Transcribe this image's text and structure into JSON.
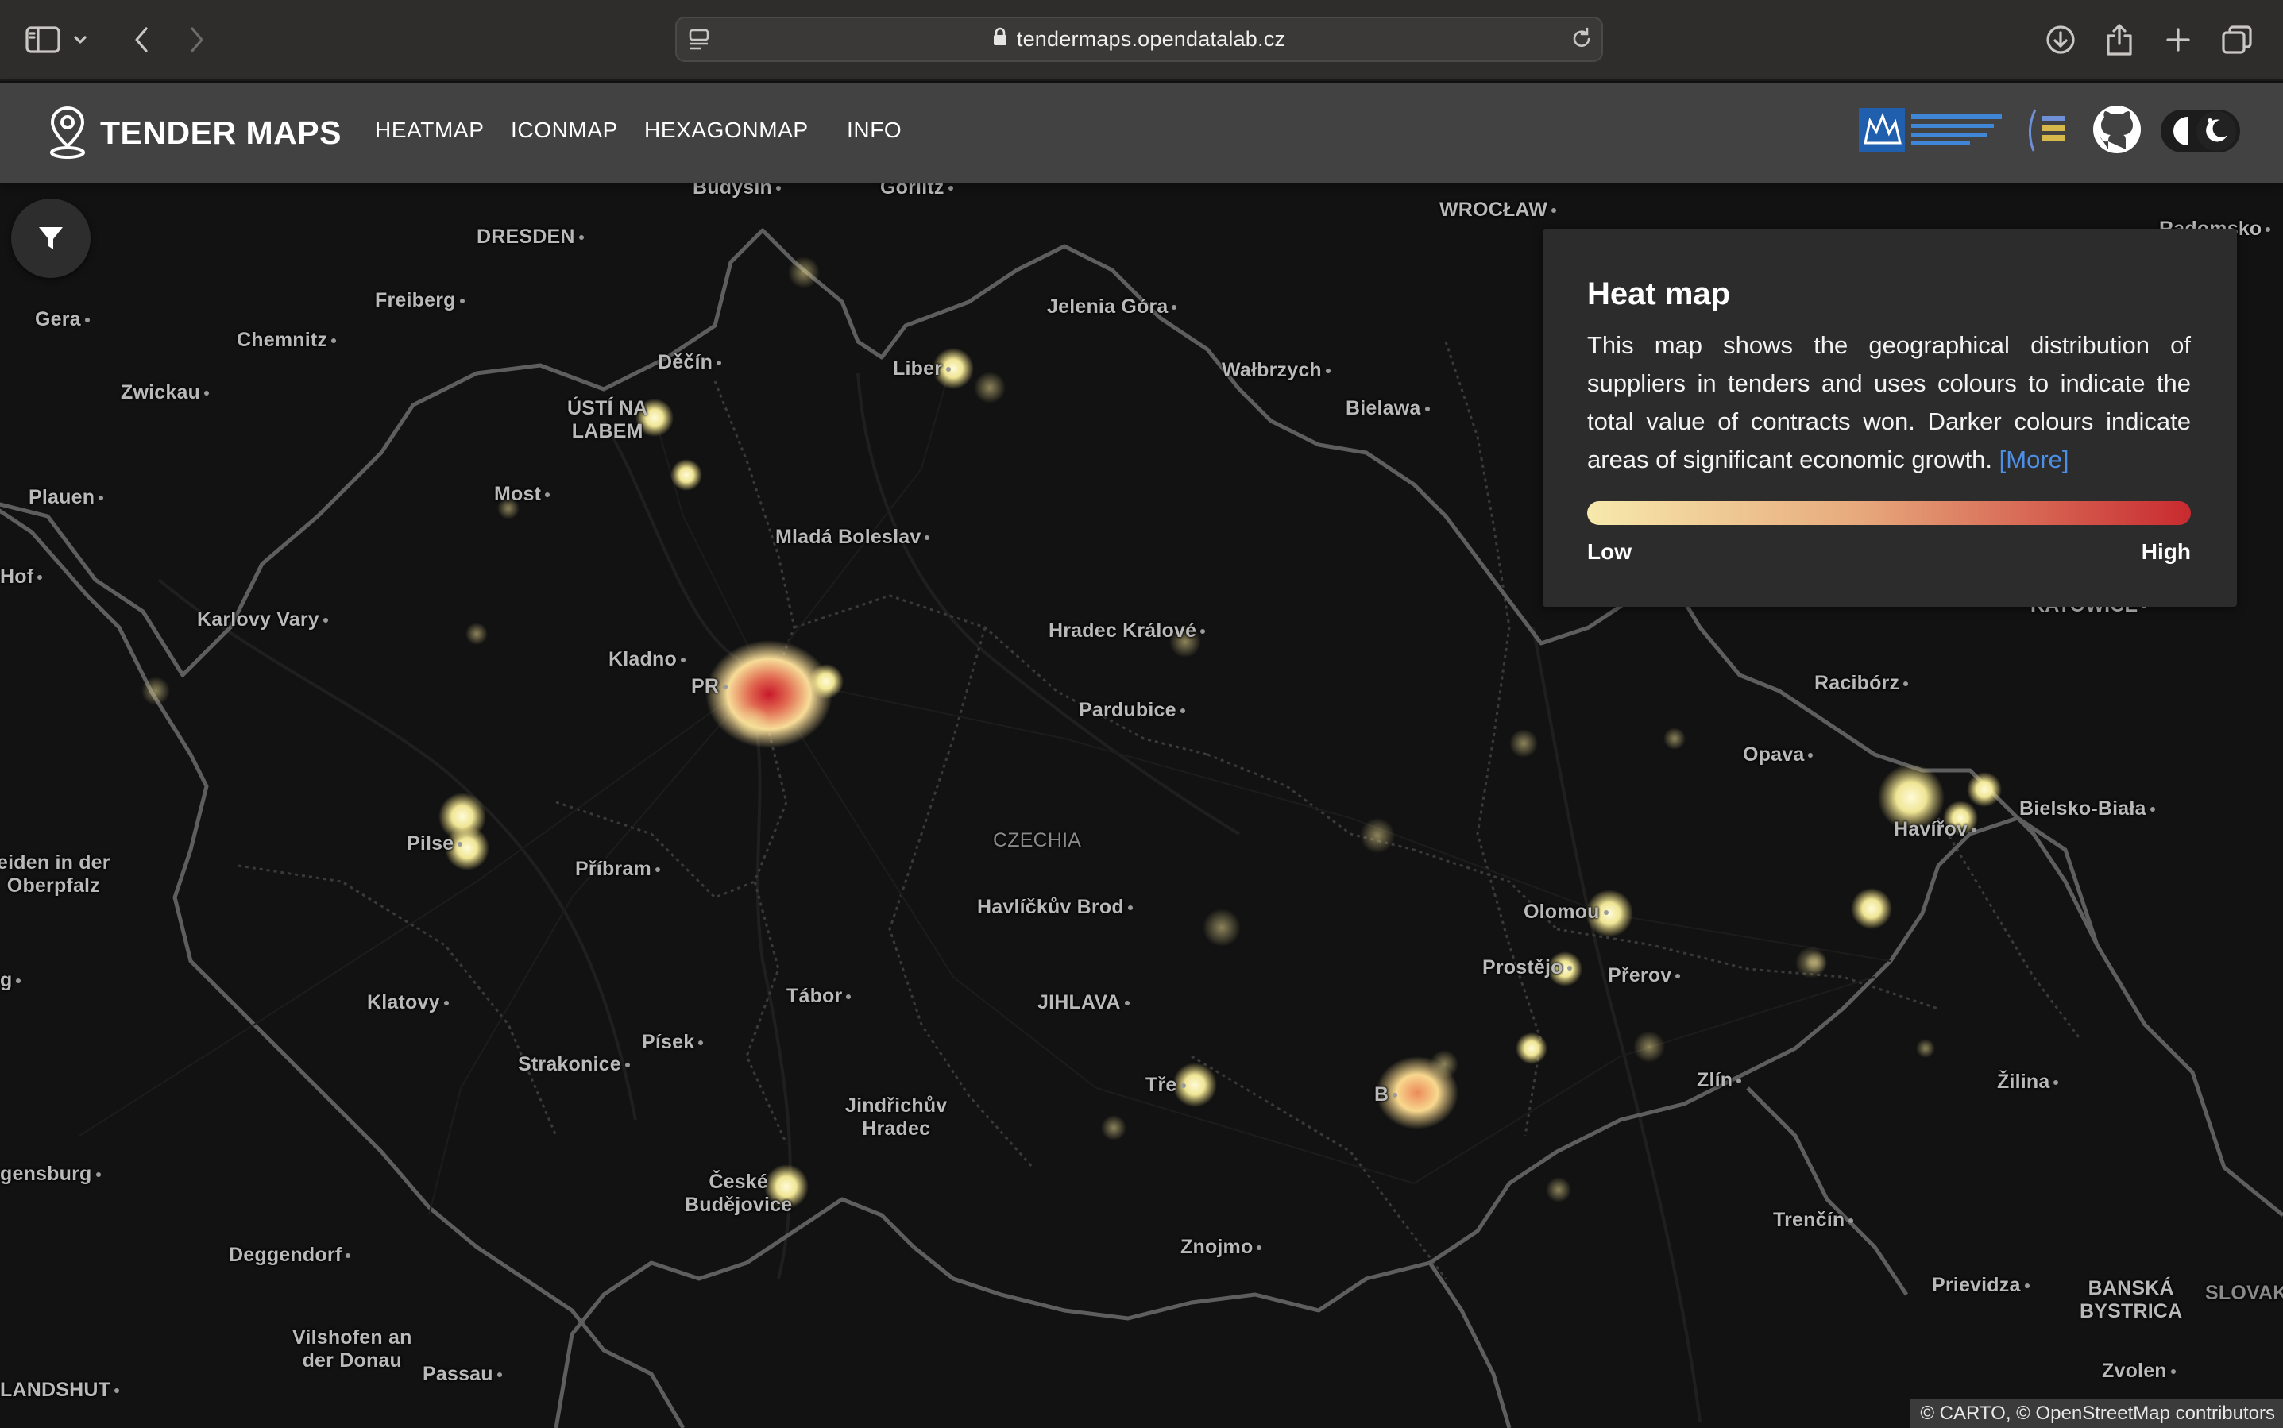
{
  "browser": {
    "url": "tendermaps.opendatalab.cz"
  },
  "nav": {
    "title": "TENDER MAPS",
    "links": [
      "HEATMAP",
      "ICONMAP",
      "HEXAGONMAP",
      "INFO"
    ]
  },
  "map": {
    "places": [
      {
        "label": "Budysin"
      },
      {
        "label": "Gorlitz"
      },
      {
        "label": "DRESDEN"
      },
      {
        "label": "WROCŁAW"
      },
      {
        "label": "Radomsko"
      },
      {
        "label": "Freiberg"
      },
      {
        "label": "Gera"
      },
      {
        "label": "Chemnitz"
      },
      {
        "label": "Jelenia Góra"
      },
      {
        "label": "Děčín"
      },
      {
        "label": "Liber"
      },
      {
        "label": "Wałbrzych"
      },
      {
        "label": "Zwickau"
      },
      {
        "label": "ÚSTÍ NA\nLABEM"
      },
      {
        "label": "Bielawa"
      },
      {
        "label": "Most"
      },
      {
        "label": "Plauen"
      },
      {
        "label": "Mladá Boleslav"
      },
      {
        "label": "Hof"
      },
      {
        "label": "Karlovy Vary"
      },
      {
        "label": "Hradec Králové"
      },
      {
        "label": "KATOWICE"
      },
      {
        "label": "Kladno"
      },
      {
        "label": "PR"
      },
      {
        "label": "Racibórz"
      },
      {
        "label": "Pardubice"
      },
      {
        "label": "Opava"
      },
      {
        "label": "Bielsko-Biała"
      },
      {
        "label": "Havířov"
      },
      {
        "label": "Pilse"
      },
      {
        "label": "CZECHIA"
      },
      {
        "label": "eiden in der\nOberpfalz"
      },
      {
        "label": "Příbram"
      },
      {
        "label": "Havlíčkův Brod"
      },
      {
        "label": "Olomou"
      },
      {
        "label": "Prostějo"
      },
      {
        "label": "Přerov"
      },
      {
        "label": "g"
      },
      {
        "label": "Tábor"
      },
      {
        "label": "Klatovy"
      },
      {
        "label": "JIHLAVA"
      },
      {
        "label": "Písek"
      },
      {
        "label": "Strakonice"
      },
      {
        "label": "Tře"
      },
      {
        "label": "B"
      },
      {
        "label": "Zlín"
      },
      {
        "label": "Žilina"
      },
      {
        "label": "Jindřichův\nHradec"
      },
      {
        "label": "gensburg"
      },
      {
        "label": "České\nBudějovice"
      },
      {
        "label": "Trenčín"
      },
      {
        "label": "Znojmo"
      },
      {
        "label": "Deggendorf"
      },
      {
        "label": "Prievidza"
      },
      {
        "label": "BANSKÁ\nBYSTRICA"
      },
      {
        "label": "SLOVAK"
      },
      {
        "label": "Vilshofen an\nder Donau"
      },
      {
        "label": "Passau"
      },
      {
        "label": "LANDSHUT"
      },
      {
        "label": "Zvolen"
      }
    ]
  },
  "legend": {
    "title": "Heat map",
    "description": "This map shows the geographical distribution of suppliers in tenders and uses colours to indicate the total value of contracts won. Darker colours indicate areas of significant economic growth.",
    "more": "[More]",
    "low": "Low",
    "high": "High",
    "colors": [
      "#f7e9ac",
      "#e7a97c",
      "#c82a2f"
    ]
  },
  "attribution": "© CARTO, © OpenStreetMap contributors"
}
